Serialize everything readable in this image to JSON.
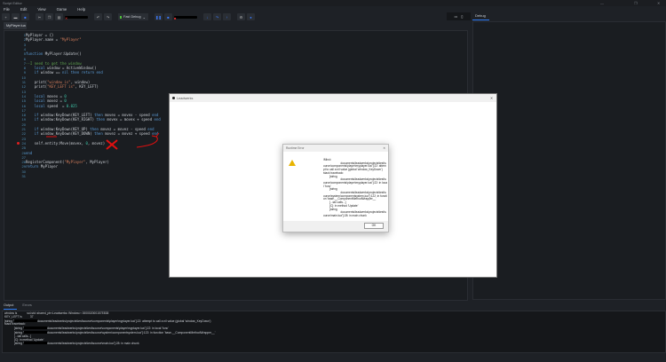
{
  "window": {
    "title": "Script Editor",
    "controls": [
      "—",
      "❐",
      "✕"
    ]
  },
  "menu": [
    "File",
    "Edit",
    "View",
    "Game",
    "Help"
  ],
  "toolbar": {
    "mode_label": "Fast Debug"
  },
  "file_tab": "MyPlayer.lua",
  "editor": {
    "breakpoint_line": 24,
    "lines": [
      [
        [
          "plain",
          "MyPlayer = {}"
        ]
      ],
      [
        [
          "plain",
          "MyPlayer.name = "
        ],
        [
          "str",
          "\"MyPlayer\""
        ]
      ],
      [],
      [],
      [
        [
          "kw",
          "function "
        ],
        [
          "plain",
          "MyPlayer:Update()"
        ]
      ],
      [],
      [
        [
          "cmt",
          "--I need to get the window"
        ]
      ],
      [
        [
          "plain",
          "    "
        ],
        [
          "kw",
          "local "
        ],
        [
          "plain",
          "window = ActiveWindow()"
        ]
      ],
      [
        [
          "plain",
          "    "
        ],
        [
          "kw",
          "if "
        ],
        [
          "plain",
          "window == "
        ],
        [
          "kw",
          "nil then return end"
        ]
      ],
      [],
      [
        [
          "plain",
          "    print("
        ],
        [
          "str",
          "\"window is\""
        ],
        [
          "plain",
          ", window)"
        ]
      ],
      [
        [
          "plain",
          "    print("
        ],
        [
          "str",
          "\"KEY_LEFT is\""
        ],
        [
          "plain",
          ", KEY_LEFT)"
        ]
      ],
      [],
      [
        [
          "plain",
          "    "
        ],
        [
          "kw",
          "local "
        ],
        [
          "plain",
          "movex = "
        ],
        [
          "num",
          "0"
        ]
      ],
      [
        [
          "plain",
          "    "
        ],
        [
          "kw",
          "local "
        ],
        [
          "plain",
          "movez = "
        ],
        [
          "num",
          "0"
        ]
      ],
      [
        [
          "plain",
          "    "
        ],
        [
          "kw",
          "local "
        ],
        [
          "plain",
          "speed  = "
        ],
        [
          "num",
          "0.025"
        ]
      ],
      [],
      [
        [
          "plain",
          "    "
        ],
        [
          "kw",
          "if "
        ],
        [
          "plain",
          "window:KeyDown(KEY_LEFT) "
        ],
        [
          "kw",
          "then "
        ],
        [
          "plain",
          "movex = movex - speed "
        ],
        [
          "kw",
          "end"
        ]
      ],
      [
        [
          "plain",
          "    "
        ],
        [
          "kw",
          "if "
        ],
        [
          "plain",
          "window:KeyDown(KEY_RIGHT) "
        ],
        [
          "kw",
          "then "
        ],
        [
          "plain",
          "movex = movex + speed "
        ],
        [
          "kw",
          "end"
        ]
      ],
      [],
      [
        [
          "plain",
          "    "
        ],
        [
          "kw",
          "if "
        ],
        [
          "plain",
          "window:KeyDown(KEY_UP) "
        ],
        [
          "kw",
          "then "
        ],
        [
          "plain",
          "movez = movez - speed "
        ],
        [
          "kw",
          "end"
        ]
      ],
      [
        [
          "plain",
          "    "
        ],
        [
          "kw",
          "if "
        ],
        [
          "plain",
          "window_KeyDown(KEY_DOWN) "
        ],
        [
          "kw",
          "then "
        ],
        [
          "plain",
          "movez = movez + speed "
        ],
        [
          "kw",
          "end"
        ]
      ],
      [],
      [
        [
          "plain",
          "    self.entity:Move(movex, "
        ],
        [
          "num",
          "0"
        ],
        [
          "plain",
          ", movez)"
        ]
      ],
      [],
      [
        [
          "kw",
          "end"
        ]
      ],
      [],
      [
        [
          "plain",
          "RegisterComponent("
        ],
        [
          "str",
          "\"MyPlayer\""
        ],
        [
          "plain",
          ", MyPlayer)"
        ]
      ],
      [
        [
          "kw",
          "return "
        ],
        [
          "plain",
          "MyPlayer"
        ]
      ],
      [],
      []
    ]
  },
  "right_panel": {
    "tab": "Debug"
  },
  "lua_window": {
    "title": "Leadwerks"
  },
  "dialog": {
    "title": "Runtime Error",
    "close": "✕",
    "ok": "OK",
    "message": "\\Mino\\\n                      documents\\leadwerks\\projects\\test\\source\\components\\player\\myplayer.lua\"]:22: attempt to call a nil value (global 'window_KeyDown')\nstack traceback:\n        [string\n                      documents\\leadwerks\\projects\\test\\source\\components\\player\\myplayer.lua\"]:22: in local 'func'\n        [string\n                      documents\\leadwerks\\projects\\test\\source\\system\\componentsystem.lua\"]:122: in function 'base.__ComponentMethodWrapper__'\n        [...tail calls...]\n        [C]: in method 'Update'\n        [string\n                      documents\\leadwerks\\projects\\test\\source\\main.lua\"]:28: in main chunk"
  },
  "output": {
    "tabs": [
      "Output",
      "Errors"
    ],
    "lines": [
      {
        "pre": "window is            sol.std::shared_ptr<Leadwerks::Window>: 000002000157E838",
        "red": false,
        "post": ""
      },
      {
        "pre": "KEY_LEFT is          37",
        "red": false,
        "post": ""
      },
      {
        "pre": "[string \"",
        "red": true,
        "post": "documents\\leadwerks\\projects\\test\\source\\components\\player\\myplayer.lua\"]:22: attempt to call a nil value (global 'window_KeyDown')"
      },
      {
        "pre": "stack traceback:",
        "red": false,
        "post": ""
      },
      {
        "pre": "            [string \"",
        "red": true,
        "post": "documents\\leadwerks\\projects\\test\\source\\components\\player\\myplayer.lua\"]:22: in local 'func'"
      },
      {
        "pre": "            [string \"",
        "red": true,
        "post": "documents\\leadwerks\\projects\\test\\source\\system\\componentsystem.lua\"]:122: in function 'base.__ComponentMethodWrapper__'"
      },
      {
        "pre": "            [...tail calls...]",
        "red": false,
        "post": ""
      },
      {
        "pre": "            [C]: in method 'Update'",
        "red": false,
        "post": ""
      },
      {
        "pre": "            [string \"",
        "red": true,
        "post": "documents\\leadwerks\\projects\\test\\source\\main.lua\"]:28: in main chunk"
      }
    ]
  }
}
